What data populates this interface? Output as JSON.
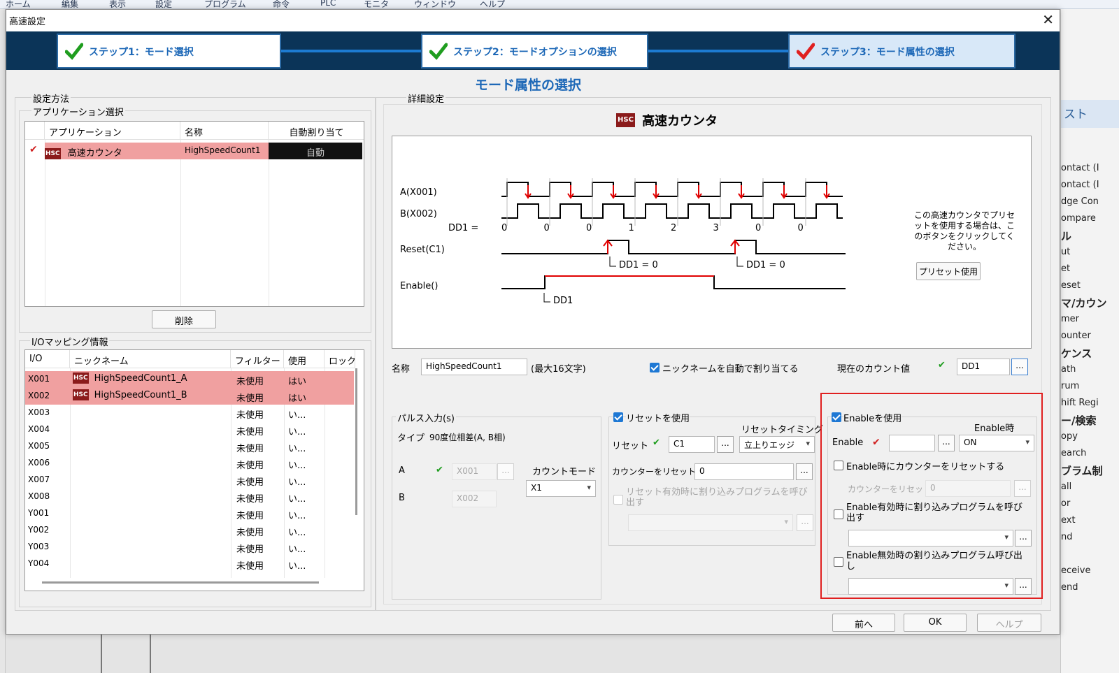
{
  "background": {
    "menu": [
      "ホーム",
      "編集",
      "表示",
      "設定",
      "プログラム",
      "命令",
      "PLC",
      "モニタ",
      "ウィンドウ",
      "ヘルプ"
    ],
    "right_title": "スト",
    "right_items": [
      "ontact (I",
      "ontact (I",
      "dge Con",
      "ompare",
      "ル",
      "ut",
      "et",
      "eset",
      "マ/カウン",
      "mer",
      "ounter",
      "ケンス",
      "ath",
      "rum",
      "hift Regi",
      "ー/検索",
      "opy",
      "earch",
      "ブラム制",
      "all",
      "or",
      "ext",
      "nd",
      "eceive",
      "end"
    ]
  },
  "dialog": {
    "title": "高速設定",
    "close": "✕"
  },
  "steps": [
    {
      "label": "ステップ1：モード選択",
      "status": "done"
    },
    {
      "label": "ステップ2：モードオプションの選択",
      "status": "done"
    },
    {
      "label": "ステップ3：モード属性の選択",
      "status": "active"
    }
  ],
  "page_title": "モード属性の選択",
  "left": {
    "method_label": "設定方法",
    "app_group_label": "アプリケーション選択",
    "app_table": {
      "headers": [
        "アプリケーション",
        "名称",
        "自動割り当て"
      ],
      "rows": [
        {
          "icon": "HSC",
          "app": "高速カウンタ",
          "name": "HighSpeedCount1",
          "auto": "自動",
          "checked": true
        }
      ]
    },
    "delete_button": "削除",
    "io_group_label": "I/Oマッピング情報",
    "io_table": {
      "headers": [
        "I/O",
        "ニックネーム",
        "フィルター",
        "使用",
        "ロック"
      ],
      "rows": [
        {
          "io": "X001",
          "nick": "HighSpeedCount1_A",
          "filter": "未使用",
          "use": "はい",
          "hl": true
        },
        {
          "io": "X002",
          "nick": "HighSpeedCount1_B",
          "filter": "未使用",
          "use": "はい",
          "hl": true
        },
        {
          "io": "X003",
          "nick": "",
          "filter": "未使用",
          "use": "い...",
          "hl": false
        },
        {
          "io": "X004",
          "nick": "",
          "filter": "未使用",
          "use": "い...",
          "hl": false
        },
        {
          "io": "X005",
          "nick": "",
          "filter": "未使用",
          "use": "い...",
          "hl": false
        },
        {
          "io": "X006",
          "nick": "",
          "filter": "未使用",
          "use": "い...",
          "hl": false
        },
        {
          "io": "X007",
          "nick": "",
          "filter": "未使用",
          "use": "い...",
          "hl": false
        },
        {
          "io": "X008",
          "nick": "",
          "filter": "未使用",
          "use": "い...",
          "hl": false
        },
        {
          "io": "Y001",
          "nick": "",
          "filter": "未使用",
          "use": "い...",
          "hl": false
        },
        {
          "io": "Y002",
          "nick": "",
          "filter": "未使用",
          "use": "い...",
          "hl": false
        },
        {
          "io": "Y003",
          "nick": "",
          "filter": "未使用",
          "use": "い...",
          "hl": false
        },
        {
          "io": "Y004",
          "nick": "",
          "filter": "未使用",
          "use": "い...",
          "hl": false
        }
      ]
    }
  },
  "detail": {
    "label": "詳細設定",
    "heading": "高速カウンタ",
    "heading_icon": "HSC",
    "diagram": {
      "signal_a": "A(X001)",
      "signal_b": "B(X002)",
      "dd1_label": "DD1 =",
      "dd1_values": [
        "0",
        "0",
        "0",
        "1",
        "2",
        "3",
        "0",
        "0"
      ],
      "reset": "Reset(C1)",
      "reset_note1": "DD1 = 0",
      "reset_note2": "DD1 = 0",
      "enable": "Enable()",
      "enable_note": "DD1",
      "preset_text": "この高速カウンタでプリセットを使用する場合は、このボタンをクリックしてください。",
      "preset_button": "プリセット使用"
    },
    "name_label": "名称",
    "name_value": "HighSpeedCount1",
    "name_max": "(最大16文字)",
    "auto_nick": "ニックネームを自動で割り当てる",
    "current_count_label": "現在のカウント値",
    "current_count_value": "DD1",
    "pulse": {
      "label": "パルス入力(s)",
      "type_label": "タイプ",
      "type_value": "90度位相差(A, B相)",
      "a_label": "A",
      "a_value": "X001",
      "b_label": "B",
      "b_value": "X002",
      "count_mode_label": "カウントモード",
      "count_mode_value": "X1"
    },
    "reset": {
      "use_label": "リセットを使用",
      "timing_label": "リセットタイミング",
      "reset_label": "リセット",
      "reset_value": "C1",
      "timing_value": "立上りエッジ",
      "counter_reset_label": "カウンターをリセット",
      "counter_reset_value": "0",
      "interrupt_label": "リセット有効時に割り込みプログラムを呼び出す"
    },
    "enable": {
      "use_label": "Enableを使用",
      "when_label": "Enable時",
      "enable_label": "Enable",
      "enable_value": "",
      "when_value": "ON",
      "reset_on_enable": "Enable時にカウンターをリセットする",
      "counter_reset_label": "カウンターをリセット",
      "counter_reset_value": "0",
      "int_enable": "Enable有効時に割り込みプログラムを呼び出す",
      "int_disable": "Enable無効時の割り込みプログラム呼び出し"
    }
  },
  "footer": {
    "back": "前へ",
    "ok": "OK",
    "help": "ヘルプ"
  },
  "colors": {
    "accent": "#1d68b7",
    "step_bar": "#0b3458",
    "highlight_row": "#f0a0a0",
    "check": "#1f9d1f",
    "signal_red": "#e00000",
    "focus_border": "#e02020"
  }
}
